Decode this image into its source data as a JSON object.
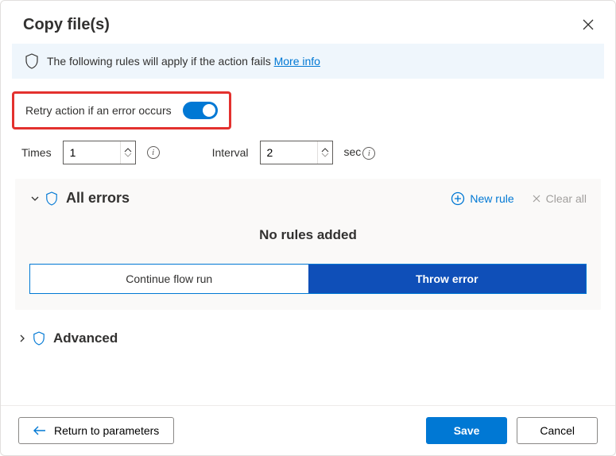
{
  "header": {
    "title": "Copy file(s)"
  },
  "banner": {
    "text": "The following rules will apply if the action fails ",
    "link": "More info"
  },
  "retry": {
    "label": "Retry action if an error occurs",
    "enabled": true,
    "times_label": "Times",
    "times_value": "1",
    "interval_label": "Interval",
    "interval_value": "2",
    "interval_unit": "sec"
  },
  "errors_panel": {
    "title": "All errors",
    "new_rule": "New rule",
    "clear_all": "Clear all",
    "empty_message": "No rules added",
    "continue_label": "Continue flow run",
    "throw_label": "Throw error",
    "selected": "throw"
  },
  "advanced": {
    "title": "Advanced"
  },
  "footer": {
    "return": "Return to parameters",
    "save": "Save",
    "cancel": "Cancel"
  },
  "colors": {
    "accent": "#0078d4",
    "highlight_border": "#e3312e"
  }
}
